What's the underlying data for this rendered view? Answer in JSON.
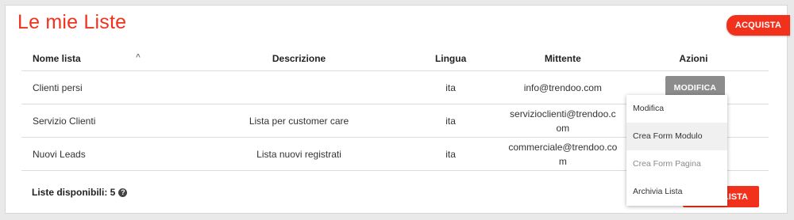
{
  "header": {
    "title": "Le mie Liste",
    "acquista_label": "ACQUISTA"
  },
  "table": {
    "columns": {
      "name": "Nome lista",
      "description": "Descrizione",
      "language": "Lingua",
      "sender": "Mittente",
      "actions": "Azioni"
    },
    "rows": [
      {
        "name": "Clienti persi",
        "description": "",
        "language": "ita",
        "sender": "info@trendoo.com"
      },
      {
        "name": "Servizio Clienti",
        "description": "Lista per customer care",
        "language": "ita",
        "sender": "servizioclienti@trendoo.com"
      },
      {
        "name": "Nuovi Leads",
        "description": "Lista nuovi registrati",
        "language": "ita",
        "sender": "commerciale@trendoo.com"
      }
    ],
    "modifica_label": "MODIFICA"
  },
  "footer": {
    "available_label": "Liste disponibili: 5",
    "crea_lista_label": "LISTA"
  },
  "dropdown": {
    "items": [
      "Modifica",
      "Crea Form Modulo",
      "Crea Form Pagina",
      "Archivia Lista"
    ]
  },
  "colors": {
    "accent": "#f2311d",
    "button_gray": "#8c8c8c"
  }
}
